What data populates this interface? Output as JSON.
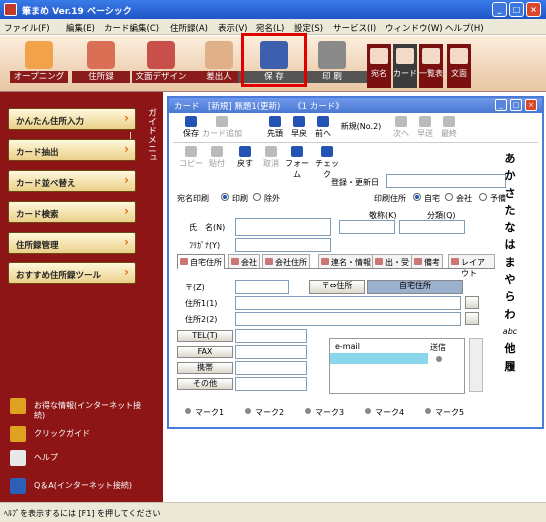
{
  "window": {
    "title": "筆まめ Ver.19 ベーシック"
  },
  "menu": [
    "ファイル(F)",
    "編集(E)",
    "カード編集(C)",
    "住所録(A)",
    "表示(V)",
    "宛名(L)",
    "設定(S)",
    "サービス(I)",
    "ウィンドウ(W)",
    "ヘルプ(H)"
  ],
  "toolbar": {
    "items": [
      {
        "label": "オープニング"
      },
      {
        "label": "住所録"
      },
      {
        "label": "文面デザイン"
      },
      {
        "label": "差出人"
      },
      {
        "label": "保 存"
      },
      {
        "label": "印 刷"
      }
    ],
    "small": [
      "宛名",
      "カード",
      "一覧表",
      "文面"
    ]
  },
  "sidebar": {
    "tab": "ガイドメニュー",
    "buttons": [
      "かんたん住所入力",
      "カード抽出",
      "カード並べ替え",
      "カード検索",
      "住所録管理",
      "おすすめ住所録ツール"
    ],
    "links": [
      "お得な情報(インターネット接続)",
      "クリックガイド",
      "ヘルプ",
      "Q＆A(インターネット接続)"
    ]
  },
  "card": {
    "title": "カード　[新規]  無題1(更新)　　《1 カード》",
    "tools": [
      "保存",
      "カード追加",
      "先頭",
      "早戻",
      "前へ",
      "新規(No.2)",
      "次へ",
      "早送",
      "最終"
    ],
    "tools2": [
      "コピー",
      "貼付",
      "戻す",
      "取消",
      "フォーム",
      "チェック"
    ],
    "reg_label": "登録・更新日",
    "atena_label": "宛名印刷",
    "print_opts": [
      "印刷",
      "除外"
    ],
    "addr_label": "印刷住所",
    "addr_opts": [
      "自宅",
      "会社",
      "予備"
    ],
    "name_label": "氏　名(N)",
    "furigana_label": "ﾌﾘｶﾞﾅ(Y)",
    "honorific_label": "敬称(K)",
    "category_label": "分類(Q)",
    "tabs": [
      "自宅住所",
      "会社",
      "会社住所",
      "連名・情報",
      "出・受",
      "備考",
      "レイアウト"
    ],
    "postal_label": "〒(Z)",
    "postal_btn": "〒⇔住所",
    "home_addr_btn": "自宅住所",
    "addr1_label": "住所1(1)",
    "addr2_label": "住所2(2)",
    "phone_buttons": [
      "TEL(T)",
      "FAX",
      "携帯",
      "その他"
    ],
    "email": {
      "col1": "e-mail",
      "col2": "送信"
    },
    "marks": [
      "マーク1",
      "マーク2",
      "マーク3",
      "マーク4",
      "マーク5"
    ],
    "kana_index": [
      "あ",
      "か",
      "さ",
      "た",
      "な",
      "は",
      "ま",
      "や",
      "ら",
      "わ",
      "abc",
      "他",
      "履"
    ]
  },
  "status": "ﾍﾙﾌﾟを表示するには [F1] を押してください"
}
